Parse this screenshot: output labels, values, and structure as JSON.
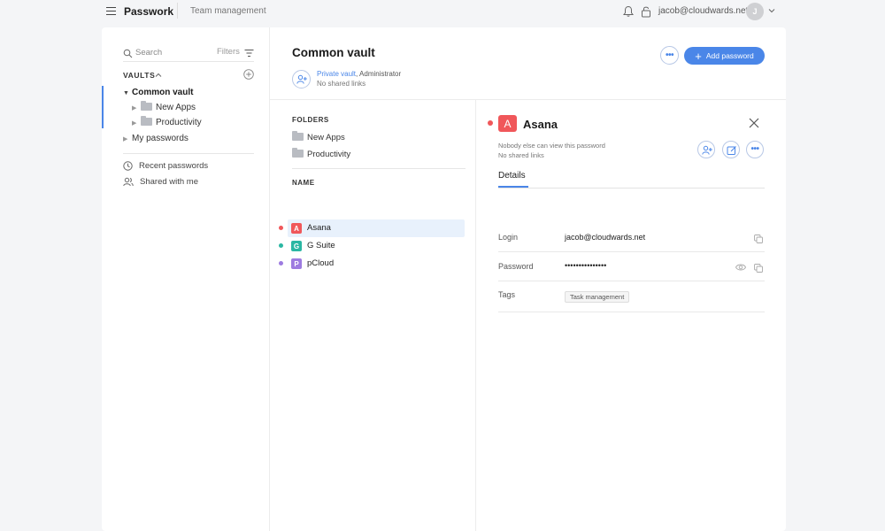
{
  "topbar": {
    "app_name": "Passwork",
    "team_link": "Team management",
    "user_email": "jacob@cloudwards.net",
    "avatar_initial": "J"
  },
  "sidebar": {
    "search_placeholder": "Search",
    "filters_label": "Filters",
    "vaults_heading": "VAULTS",
    "vault_name": "Common vault",
    "folders": [
      {
        "label": "New Apps"
      },
      {
        "label": "Productivity"
      }
    ],
    "my_passwords": "My passwords",
    "nav": {
      "recent": "Recent passwords",
      "shared": "Shared with me"
    }
  },
  "vault": {
    "title": "Common vault",
    "access_type": "Private vault",
    "role": ", Administrator",
    "shared_links": "No shared links",
    "add_label": "Add password"
  },
  "list": {
    "folders_heading": "FOLDERS",
    "folders": [
      {
        "label": "New Apps"
      },
      {
        "label": "Productivity"
      }
    ],
    "name_heading": "NAME",
    "passwords": [
      {
        "initial": "A",
        "name": "Asana",
        "color": "#f0575a",
        "selected": true
      },
      {
        "initial": "G",
        "name": "G Suite",
        "color": "#2bb7a3",
        "selected": false
      },
      {
        "initial": "P",
        "name": "pCloud",
        "color": "#9d7be0",
        "selected": false
      }
    ]
  },
  "detail": {
    "initial": "A",
    "title": "Asana",
    "color": "#f0575a",
    "visibility": "Nobody else can view this password",
    "shared_links": "No shared links",
    "tab": "Details",
    "fields": {
      "login_label": "Login",
      "login_value": "jacob@cloudwards.net",
      "password_label": "Password",
      "password_value": "•••••••••••••••",
      "tags_label": "Tags",
      "tag": "Task management"
    }
  },
  "colors": {
    "accent": "#4a86e8",
    "background": "#f4f5f7"
  }
}
